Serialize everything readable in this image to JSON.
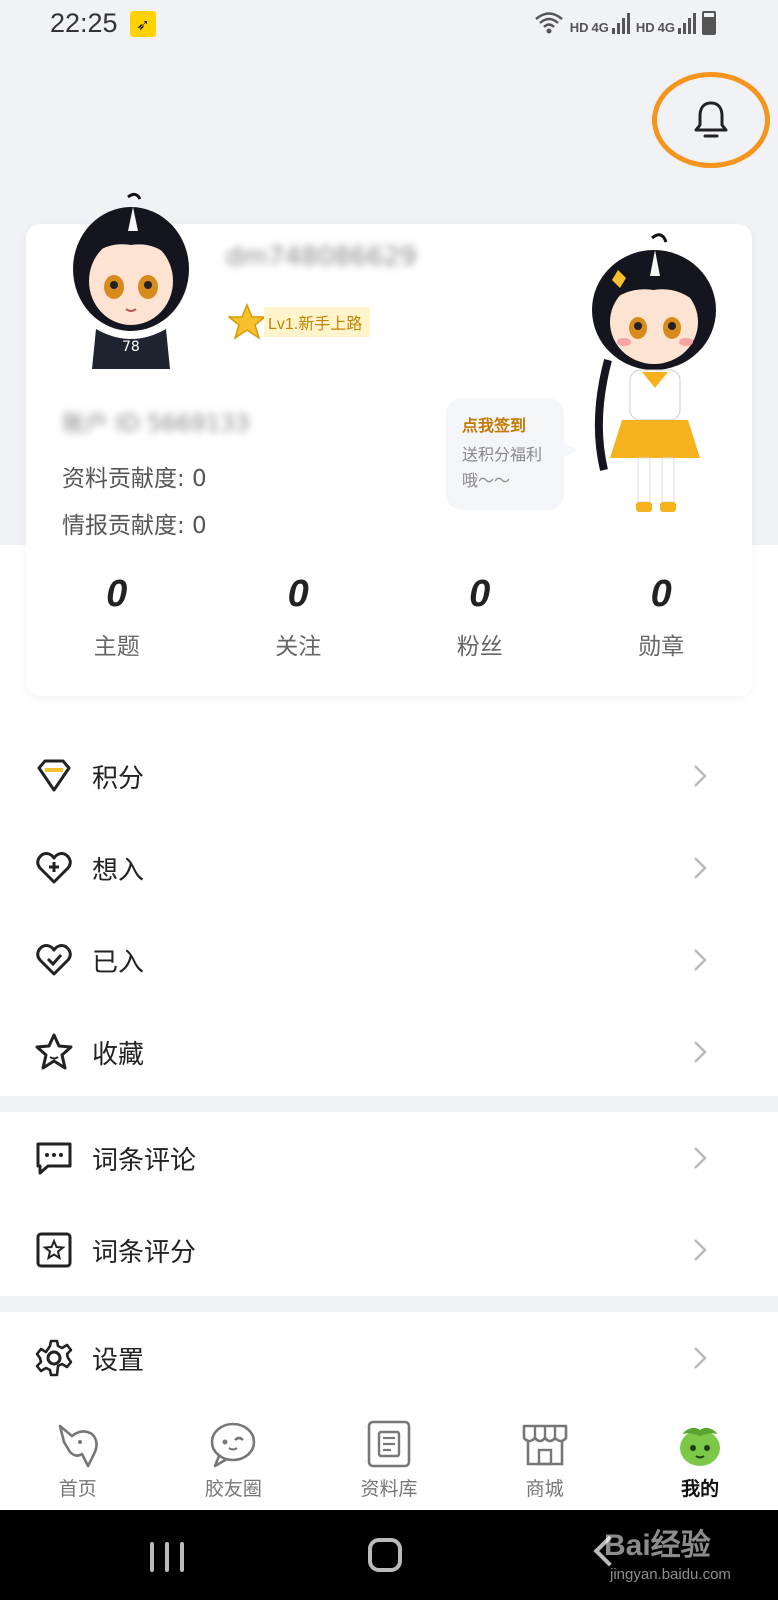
{
  "status_bar": {
    "time": "22:25",
    "hd1": "HD",
    "net1": "4G",
    "hd2": "HD",
    "net2": "4G"
  },
  "profile": {
    "username": "dm748086629",
    "level": "Lv1.新手上路",
    "account_id": "账户 ID 5669133",
    "data_contribution": "资料贡献度: 0",
    "intel_contribution": "情报贡献度: 0",
    "signin": {
      "title": "点我签到",
      "desc": "送积分福利哦～～"
    },
    "stats": [
      {
        "value": "0",
        "label": "主题"
      },
      {
        "value": "0",
        "label": "关注"
      },
      {
        "value": "0",
        "label": "粉丝"
      },
      {
        "value": "0",
        "label": "勋章"
      }
    ]
  },
  "menu_groups": [
    {
      "items": [
        {
          "label": "积分",
          "icon": "diamond-icon"
        },
        {
          "label": "想入",
          "icon": "heart-plus-icon"
        },
        {
          "label": "已入",
          "icon": "heart-check-icon"
        },
        {
          "label": "收藏",
          "icon": "star-icon"
        }
      ]
    },
    {
      "items": [
        {
          "label": "词条评论",
          "icon": "comment-icon"
        },
        {
          "label": "词条评分",
          "icon": "rating-icon"
        }
      ]
    },
    {
      "items": [
        {
          "label": "设置",
          "icon": "gear-icon"
        }
      ]
    }
  ],
  "bottom_nav": [
    {
      "label": "首页",
      "icon": "unicorn-icon",
      "active": false
    },
    {
      "label": "胶友圈",
      "icon": "chat-bubble-icon",
      "active": false
    },
    {
      "label": "资料库",
      "icon": "library-icon",
      "active": false
    },
    {
      "label": "商城",
      "icon": "shop-icon",
      "active": false
    },
    {
      "label": "我的",
      "icon": "green-mascot-icon",
      "active": true
    }
  ],
  "watermark": {
    "brand": "Bai经验",
    "url": "jingyan.baidu.com"
  },
  "colors": {
    "accent_orange": "#f7941d",
    "level_text": "#c48400",
    "page_bg": "#f1f2f6"
  }
}
